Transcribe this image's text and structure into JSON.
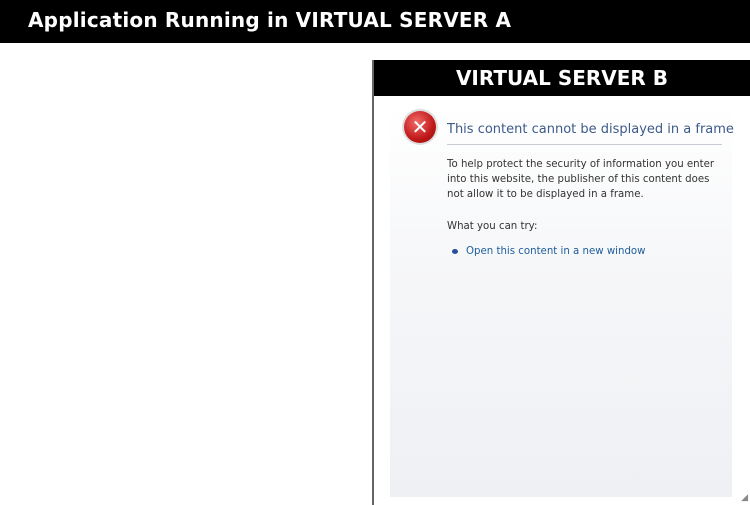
{
  "app_title": "Application Running in VIRTUAL SERVER A",
  "frame": {
    "title": "VIRTUAL SERVER B",
    "error_heading": "This content cannot be displayed in a frame",
    "error_body": "To help protect the security of information you enter into this website, the publisher of this content does not allow it to be displayed in a frame.",
    "try_label": "What you can try:",
    "link_label": "Open this content in a new window",
    "icon": "error-x-icon"
  }
}
